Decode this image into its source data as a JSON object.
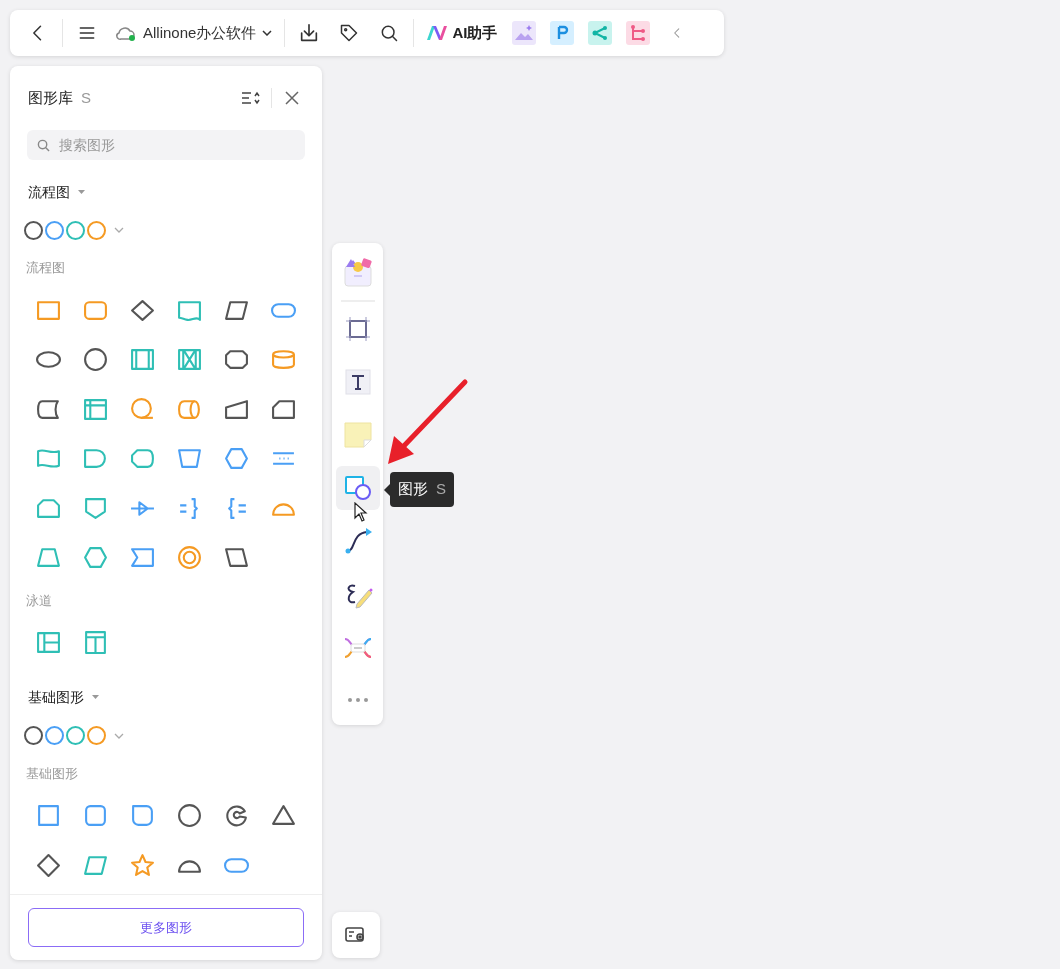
{
  "toolbar": {
    "document_title": "Allinone办公软件",
    "ai_label": "AI助手"
  },
  "shape_panel": {
    "title": "图形库",
    "shortcut": "S",
    "search": {
      "placeholder": "搜索图形"
    },
    "sections": [
      {
        "title": "流程图",
        "swatches": [
          {
            "color": "#555555"
          },
          {
            "color": "#4a9ff5"
          },
          {
            "color": "#2fbfb5"
          },
          {
            "color": "#f59a23"
          }
        ],
        "groups": [
          {
            "label": "流程图",
            "kind": "flowchart"
          },
          {
            "label": "泳道",
            "kind": "swimlane"
          }
        ]
      },
      {
        "title": "基础图形",
        "swatches": [
          {
            "color": "#555555"
          },
          {
            "color": "#4a9ff5"
          },
          {
            "color": "#2fbfb5"
          },
          {
            "color": "#f59a23"
          }
        ],
        "groups": [
          {
            "label": "基础图形",
            "kind": "basic"
          }
        ]
      }
    ],
    "more_button": "更多图形"
  },
  "tools": [
    {
      "kind": "template",
      "selected": false
    },
    {
      "kind": "frame",
      "selected": false
    },
    {
      "kind": "text",
      "selected": false
    },
    {
      "kind": "sticky",
      "selected": false
    },
    {
      "kind": "shape",
      "selected": true
    },
    {
      "kind": "connector",
      "selected": false
    },
    {
      "kind": "pen",
      "selected": false
    },
    {
      "kind": "mindmap",
      "selected": false
    },
    {
      "kind": "more",
      "selected": false
    }
  ],
  "tooltip": {
    "label": "图形",
    "shortcut": "S"
  }
}
